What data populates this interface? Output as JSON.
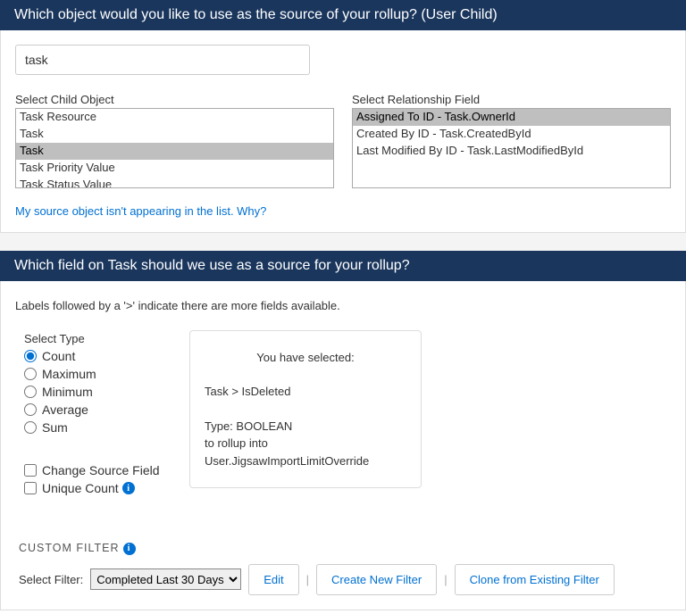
{
  "section1": {
    "title": "Which object would you like to use as the source of your rollup? (User Child)",
    "search_value": "task",
    "child_label": "Select Child Object",
    "child_items": [
      {
        "label": "Task Resource",
        "selected": false
      },
      {
        "label": "Task",
        "selected": false
      },
      {
        "label": "Task",
        "selected": true
      },
      {
        "label": "Task Priority Value",
        "selected": false
      },
      {
        "label": "Task Status Value",
        "selected": false
      }
    ],
    "relationship_label": "Select Relationship Field",
    "relationship_items": [
      {
        "label": "Assigned To ID - Task.OwnerId",
        "selected": true
      },
      {
        "label": "Created By ID - Task.CreatedById",
        "selected": false
      },
      {
        "label": "Last Modified By ID - Task.LastModifiedById",
        "selected": false
      }
    ],
    "help_link": "My source object isn't appearing in the list. Why?"
  },
  "section2": {
    "title": "Which field on Task should we use as a source for your rollup?",
    "subtext": "Labels followed by a '>' indicate there are more fields available.",
    "type_label": "Select Type",
    "types": [
      {
        "label": "Count",
        "checked": true
      },
      {
        "label": "Maximum",
        "checked": false
      },
      {
        "label": "Minimum",
        "checked": false
      },
      {
        "label": "Average",
        "checked": false
      },
      {
        "label": "Sum",
        "checked": false
      }
    ],
    "change_source_label": "Change Source Field",
    "unique_count_label": "Unique Count",
    "preview": {
      "title": "You have selected:",
      "path": "Task > IsDeleted",
      "type_line": "Type: BOOLEAN",
      "rollup_line": "to rollup into",
      "target": "User.JigsawImportLimitOverride"
    },
    "filter": {
      "title": "CUSTOM FILTER",
      "select_label": "Select Filter:",
      "selected": "Completed Last 30 Days",
      "edit": "Edit",
      "create": "Create New Filter",
      "clone": "Clone from Existing Filter"
    }
  }
}
